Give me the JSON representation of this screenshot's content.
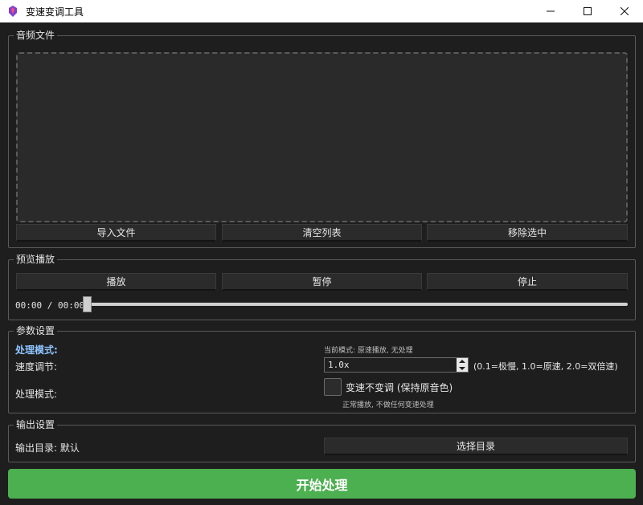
{
  "window": {
    "title": "变速变调工具",
    "controls": {
      "minimize": "—",
      "maximize": "☐",
      "close": "✕"
    }
  },
  "audio_files": {
    "group_title": "音频文件",
    "import_button": "导入文件",
    "clear_button": "清空列表",
    "remove_button": "移除选中"
  },
  "preview": {
    "group_title": "预览播放",
    "play_button": "播放",
    "pause_button": "暂停",
    "stop_button": "停止",
    "time_display": "00:00 / 00:00",
    "progress": 0
  },
  "params": {
    "group_title": "参数设置",
    "mode_heading": "处理模式:",
    "current_mode_text": "当前模式: 原速播放, 无处理",
    "speed_label": "速度调节:",
    "speed_value": "1.0x",
    "speed_hint": "(0.1=极慢, 1.0=原速, 2.0=双倍速)",
    "mode_label": "处理模式:",
    "pitch_checkbox_label": "变速不变调 (保持原音色)",
    "pitch_checkbox_checked": false,
    "mode_hint": "正常播放, 不做任何变速处理"
  },
  "output": {
    "group_title": "输出设置",
    "dir_label": "输出目录: 默认",
    "choose_dir_button": "选择目录"
  },
  "start_button": "开始处理",
  "colors": {
    "accent_green": "#4caf50",
    "accent_blue": "#8ec5ff",
    "background": "#1e1e1e"
  }
}
